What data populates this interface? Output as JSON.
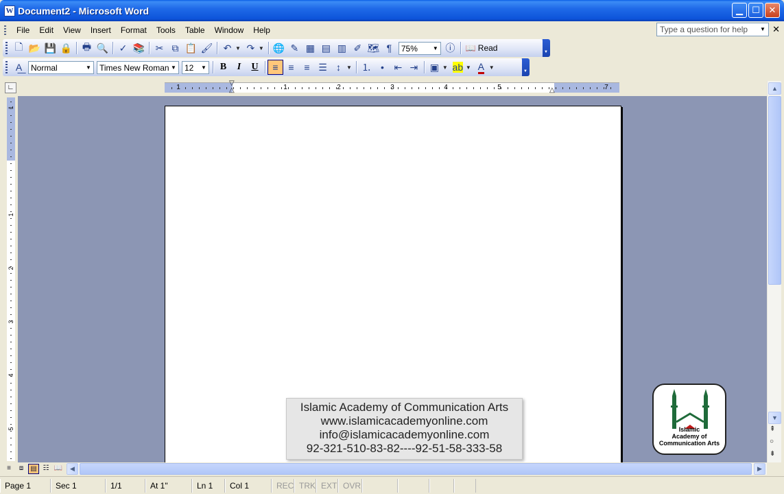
{
  "window": {
    "title": "Document2 - Microsoft Word",
    "app_icon": "W"
  },
  "menu": {
    "items": [
      "File",
      "Edit",
      "View",
      "Insert",
      "Format",
      "Tools",
      "Table",
      "Window",
      "Help"
    ],
    "help_placeholder": "Type a question for help"
  },
  "standard_toolbar": {
    "zoom": "75%",
    "read_label": "Read"
  },
  "formatting_toolbar": {
    "style": "Normal",
    "font": "Times New Roman",
    "size": "12",
    "bold": "B",
    "italic": "I",
    "underline": "U"
  },
  "ruler": {
    "numbers": [
      "1",
      "1",
      "2",
      "3",
      "4",
      "5",
      "7"
    ],
    "v_numbers": [
      "1",
      "1",
      "2",
      "3",
      "4",
      "5"
    ]
  },
  "watermark": {
    "lines": [
      "Islamic Academy of Communication Arts",
      "www.islamicacademyonline.com",
      "info@islamicacademyonline.com",
      "92-321-510-83-82----92-51-58-333-58"
    ],
    "logo_text": [
      "Islamic",
      "Academy of",
      "Communication Arts"
    ]
  },
  "status": {
    "page": "Page 1",
    "sec": "Sec 1",
    "pages": "1/1",
    "at": "At 1\"",
    "ln": "Ln 1",
    "col": "Col 1",
    "rec": "REC",
    "trk": "TRK",
    "ext": "EXT",
    "ovr": "OVR"
  },
  "colors": {
    "titlebar": "#0d54da",
    "accent_active": "#ffc77a",
    "page_bg": "#8c96b4"
  }
}
